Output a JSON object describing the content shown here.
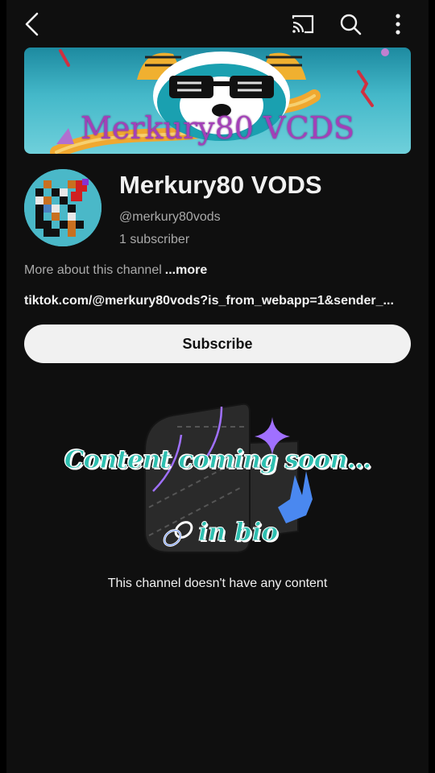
{
  "topbar": {
    "back_icon": "back-arrow-icon",
    "cast_icon": "cast-icon",
    "search_icon": "search-icon",
    "more_icon": "more-vertical-icon"
  },
  "banner": {
    "text": "Merkury80 VCDS"
  },
  "channel": {
    "name": "Merkury80 VODS",
    "handle": "@merkury80vods",
    "subscribers": "1 subscriber",
    "about_text": "More about this channel",
    "about_more": "...more",
    "link": "tiktok.com/@merkury80vods?is_from_webapp=1&sender_..."
  },
  "subscribe": {
    "label": "Subscribe"
  },
  "empty_state": {
    "graphic_line1": "Content coming soon...",
    "graphic_line2": "in bio",
    "message": "This channel doesn't have any content"
  },
  "colors": {
    "background": "#0f0f0f",
    "text_primary": "#f1f1f1",
    "text_secondary": "#aaaaaa",
    "accent_teal": "#2dbfb0",
    "accent_purple": "#a340b8"
  }
}
